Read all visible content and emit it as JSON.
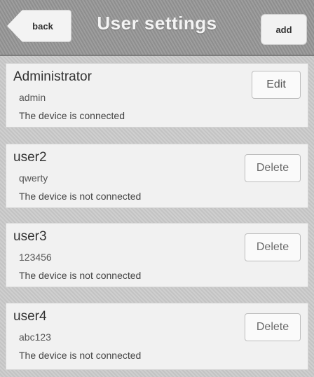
{
  "header": {
    "back_label": "back",
    "title": "User settings",
    "add_label": "add"
  },
  "users": [
    {
      "name": "Administrator",
      "password": "admin",
      "status": "The device is connected",
      "action_label": "Edit"
    },
    {
      "name": "user2",
      "password": "qwerty",
      "status": "The device is not connected",
      "action_label": "Delete"
    },
    {
      "name": "user3",
      "password": "123456",
      "status": "The device is not connected",
      "action_label": "Delete"
    },
    {
      "name": "user4",
      "password": "abc123",
      "status": "The device is not connected",
      "action_label": "Delete"
    }
  ],
  "colors": {
    "header_bg": "#9a9a9a",
    "card_bg": "#f1f1f1",
    "screen_bg": "#c9c9c9"
  }
}
